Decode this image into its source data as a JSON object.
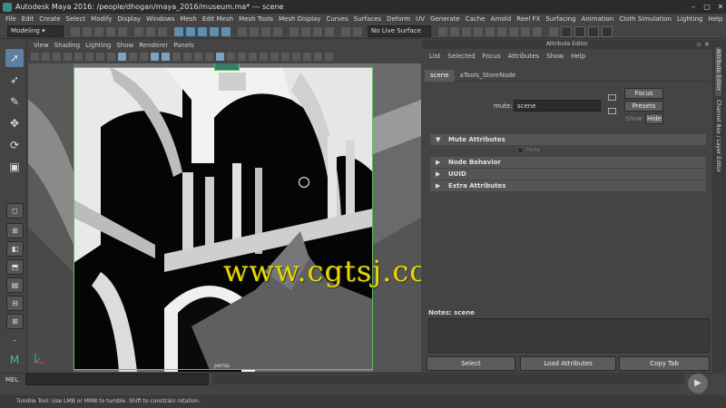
{
  "window": {
    "title": "Autodesk Maya 2016: /people/dhogan/maya_2016/museum.ma*   ---   scene",
    "controls": [
      "–",
      "▢",
      "✕"
    ]
  },
  "menubar": [
    "File",
    "Edit",
    "Create",
    "Select",
    "Modify",
    "Display",
    "Windows",
    "Mesh",
    "Edit Mesh",
    "Mesh Tools",
    "Mesh Display",
    "Curves",
    "Surfaces",
    "Deform",
    "UV",
    "Generate",
    "Cache",
    "Arnold",
    "Reel FX",
    "Surfacing",
    "Animation",
    "Cloth Simulation",
    "Lighting",
    "Help"
  ],
  "statusline": {
    "menuset": "Modeling",
    "live_surface": "No Live Surface"
  },
  "viewport": {
    "menu": [
      "View",
      "Shading",
      "Lighting",
      "Show",
      "Renderer",
      "Panels"
    ],
    "hud_label": "persp",
    "watermark": "www.cgtsj.com"
  },
  "attribute_editor": {
    "header": "Attribute Editor",
    "menu": [
      "List",
      "Selected",
      "Focus",
      "Attributes",
      "Show",
      "Help"
    ],
    "tabs": [
      "scene",
      "aTools_StoreNode"
    ],
    "active_tab": "scene",
    "name_label": "mute:",
    "name_value": "scene",
    "buttons": {
      "focus": "Focus",
      "presets": "Presets",
      "show": "Show",
      "hide": "Hide"
    },
    "sections": [
      {
        "label": "Mute Attributes",
        "expanded": true
      },
      {
        "label": "Node Behavior",
        "expanded": false
      },
      {
        "label": "UUID",
        "expanded": false
      },
      {
        "label": "Extra Attributes",
        "expanded": false
      }
    ],
    "mute_checkbox_label": "Mute",
    "notes_label": "Notes:  scene",
    "bottom_buttons": [
      "Select",
      "Load Attributes",
      "Copy Tab"
    ]
  },
  "side_tabs": [
    "Attribute Editor",
    "Channel Box / Layer Editor"
  ],
  "command_line": {
    "label": "MEL"
  },
  "help_line": "Tumble Tool: Use LMB or MMB to tumble. Shift to constrain rotation."
}
